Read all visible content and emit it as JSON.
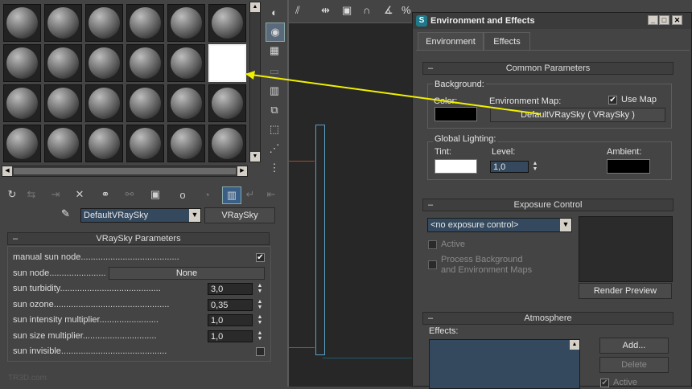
{
  "material_editor": {
    "selected_slot": 11,
    "rows": 4,
    "cols": 6,
    "material_name": "DefaultVRaySky",
    "material_type": "VRaySky",
    "rollout_title": "VRaySky Parameters",
    "params": {
      "manual_sun_node_label": "manual sun node........................................",
      "manual_sun_node_checked": "✔",
      "sun_node_label": "sun node........................",
      "sun_node_value": "None",
      "sun_turbidity_label": "sun turbidity.........................................",
      "sun_turbidity_value": "3,0",
      "sun_ozone_label": "sun ozone...............................................",
      "sun_ozone_value": "0,35",
      "sun_intensity_label": "sun intensity multiplier........................",
      "sun_intensity_value": "1,0",
      "sun_size_label": "sun size multiplier..............................",
      "sun_size_value": "1,0",
      "sun_invisible_label": "sun invisible..........................................."
    },
    "watermark": "TR3D.com"
  },
  "env_dialog": {
    "title": "Environment and Effects",
    "tabs": {
      "environment": "Environment",
      "effects": "Effects"
    },
    "common": {
      "header": "Common Parameters",
      "background_label": "Background:",
      "color_label": "Color:",
      "env_map_label": "Environment Map:",
      "use_map_label": "Use Map",
      "use_map_checked": "✔",
      "env_map_button": "DefaultVRaySky  ( VRaySky )",
      "global_lighting_label": "Global Lighting:",
      "tint_label": "Tint:",
      "level_label": "Level:",
      "level_value": "1,0",
      "ambient_label": "Ambient:"
    },
    "exposure": {
      "header": "Exposure Control",
      "selected": "<no exposure control>",
      "active_label": "Active",
      "process_label_1": "Process Background",
      "process_label_2": "and Environment Maps",
      "render_preview": "Render Preview"
    },
    "atmosphere": {
      "header": "Atmosphere",
      "effects_label": "Effects:",
      "add_button": "Add...",
      "delete_button": "Delete",
      "active_label": "Active"
    }
  },
  "colors": {
    "background_swatch": "#000000",
    "tint_swatch": "#ffffff",
    "ambient_swatch": "#000000",
    "arrow": "#f0f000"
  }
}
